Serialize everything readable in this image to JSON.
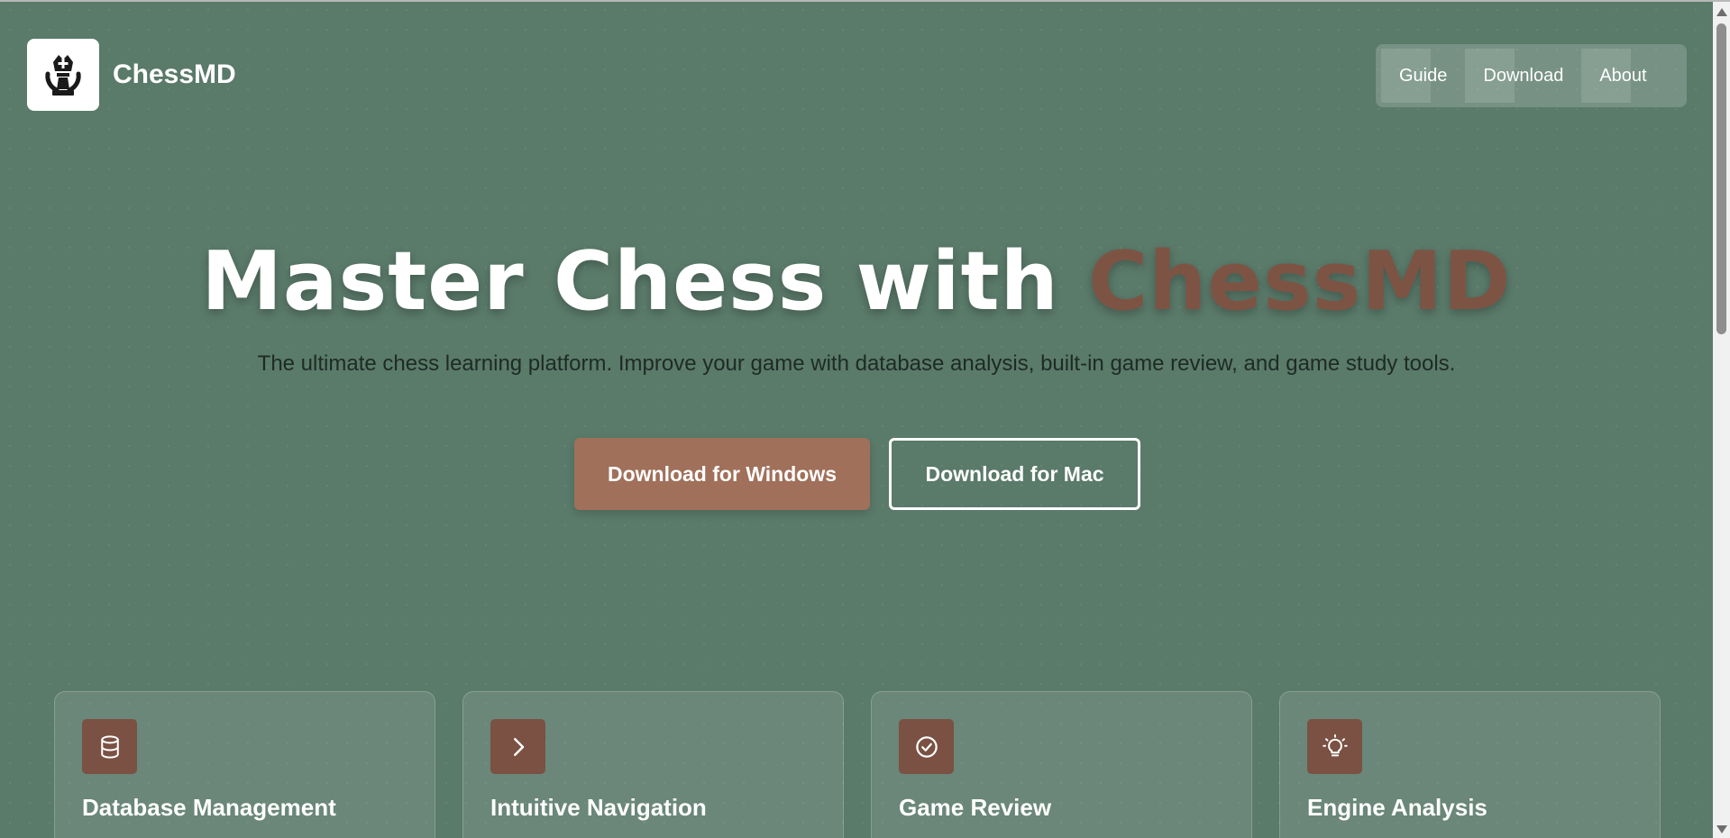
{
  "header": {
    "brand": "ChessMD",
    "nav": [
      {
        "label": "Guide"
      },
      {
        "label": "Download"
      },
      {
        "label": "About"
      }
    ]
  },
  "hero": {
    "title_main": "Master Chess with ",
    "title_accent": "ChessMD",
    "subtitle": "The ultimate chess learning platform. Improve your game with database analysis, built-in game review, and game study tools.",
    "btn_windows": "Download for Windows",
    "btn_mac": "Download for Mac"
  },
  "features": [
    {
      "title": "Database Management",
      "icon": "database-icon"
    },
    {
      "title": "Intuitive Navigation",
      "icon": "chevron-right-icon"
    },
    {
      "title": "Game Review",
      "icon": "check-circle-icon"
    },
    {
      "title": "Engine Analysis",
      "icon": "lightbulb-icon"
    }
  ],
  "colors": {
    "background": "#5a7a6a",
    "accent": "#7d5444",
    "primary_button": "#a0705a",
    "icon_bg": "#7a5142"
  }
}
